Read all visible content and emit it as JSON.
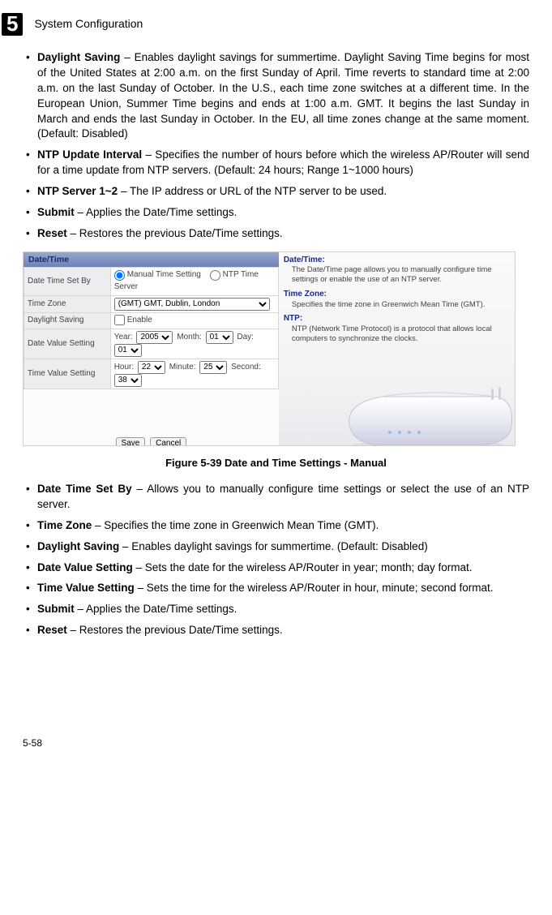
{
  "chapter": {
    "num": "5",
    "title": "System Configuration"
  },
  "list1": {
    "i1b": "Daylight Saving",
    "i1t": " – Enables daylight savings for summertime. Daylight Saving Time begins for most of the United States at 2:00 a.m. on the first Sunday of April. Time reverts to standard time at 2:00 a.m. on the last Sunday of October. In the U.S., each time zone switches at a different time. In the European Union, Summer Time begins and ends at 1:00 a.m. GMT. It begins the last Sunday in March and ends the last Sunday in October. In the EU, all time zones change at the same moment. (Default: Disabled)",
    "i2b": "NTP Update Interval",
    "i2t": " – Specifies the number of hours before which the wireless AP/Router will send for a time update from NTP servers. (Default: 24 hours; Range 1~1000 hours)",
    "i3b": "NTP Server 1~2",
    "i3t": " – The IP address or URL of the NTP server to be used.",
    "i4b": "Submit",
    "i4t": " – Applies the Date/Time settings.",
    "i5b": "Reset",
    "i5t": " – Restores the previous Date/Time settings."
  },
  "figure": {
    "header": "Date/Time",
    "rows": {
      "r1": "Date Time Set By",
      "r2": "Time Zone",
      "r3": "Daylight Saving",
      "r4": "Date Value Setting",
      "r5": "Time Value Setting"
    },
    "controls": {
      "opt_manual": "Manual Time Setting",
      "opt_ntp": "NTP Time Server",
      "tz_value": "(GMT) GMT, Dublin, London",
      "enable": "Enable",
      "year_lbl": "Year:",
      "year_val": "2005",
      "month_lbl": "Month:",
      "month_val": "01",
      "day_lbl": "Day:",
      "day_val": "01",
      "hour_lbl": "Hour:",
      "hour_val": "22",
      "min_lbl": "Minute:",
      "min_val": "25",
      "sec_lbl": "Second:",
      "sec_val": "38",
      "save": "Save",
      "cancel": "Cancel"
    },
    "help": {
      "h1t": "Date/Time:",
      "h1d": "The Date/Time page allows you to manually configure time settings or enable the use of an NTP server.",
      "h2t": "Time Zone:",
      "h2d": "Specifies the time zone in Greenwich Mean Time (GMT).",
      "h3t": "NTP:",
      "h3d": "NTP (Network Time Protocol) is a protocol that allows local computers to synchronize the clocks."
    },
    "caption": "Figure 5-39  Date and Time Settings - Manual"
  },
  "list2": {
    "i1b": "Date Time Set By",
    "i1t": " – Allows you to manually configure time settings or select the use of an NTP server.",
    "i2b": "Time Zone",
    "i2t": " – Specifies the time zone in Greenwich Mean Time (GMT).",
    "i3b": "Daylight Saving",
    "i3t": " – Enables daylight savings for summertime. (Default: Disabled)",
    "i4b": "Date Value Setting",
    "i4t": " – Sets the date for the wireless AP/Router in year; month; day format.",
    "i5b": "Time Value Setting",
    "i5t": " – Sets the time for the wireless AP/Router in hour, minute; second format.",
    "i6b": "Submit",
    "i6t": " – Applies the Date/Time settings.",
    "i7b": "Reset",
    "i7t": " – Restores the previous Date/Time settings."
  },
  "page": "5-58"
}
